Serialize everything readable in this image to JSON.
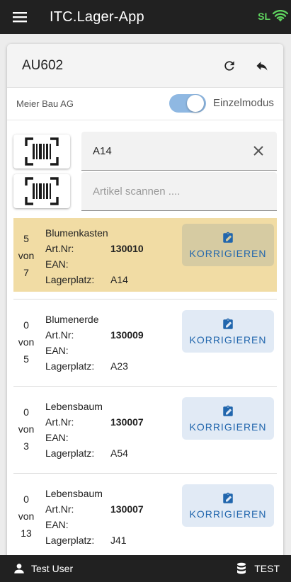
{
  "app": {
    "title": "ITC.Lager-App",
    "status": "SL"
  },
  "order": {
    "number": "AU602",
    "customer": "Meier Bau AG",
    "mode_label": "Einzelmodus",
    "mode_enabled": true
  },
  "scan": {
    "location_value": "A14",
    "article_placeholder": "Artikel scannen ...."
  },
  "labels": {
    "von": "von",
    "artnr": "Art.Nr:",
    "ean": "EAN:",
    "lagerplatz": "Lagerplatz:",
    "korrigieren": "KORRIGIEREN"
  },
  "items": [
    {
      "qty_done": "5",
      "qty_total": "7",
      "name": "Blumenkasten",
      "artnr": "130010",
      "ean": "",
      "lagerplatz": "A14",
      "active": true
    },
    {
      "qty_done": "0",
      "qty_total": "5",
      "name": "Blumenerde",
      "artnr": "130009",
      "ean": "",
      "lagerplatz": "A23",
      "active": false
    },
    {
      "qty_done": "0",
      "qty_total": "3",
      "name": "Lebensbaum",
      "artnr": "130007",
      "ean": "",
      "lagerplatz": "A54",
      "active": false
    },
    {
      "qty_done": "0",
      "qty_total": "13",
      "name": "Lebensbaum",
      "artnr": "130007",
      "ean": "",
      "lagerplatz": "J41",
      "active": false
    }
  ],
  "footer": {
    "user": "Test User",
    "environment": "TEST"
  },
  "colors": {
    "accent": "#2166ad",
    "active_row": "#f1dca4",
    "status": "#5fd35f",
    "bar": "#212121"
  }
}
